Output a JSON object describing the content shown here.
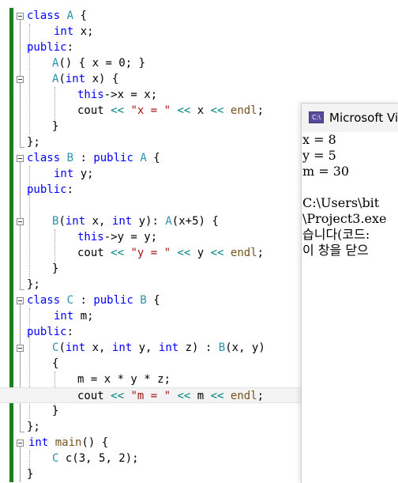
{
  "editor": {
    "lines": [
      "class A {",
      "int x;",
      "public:",
      "A() { x = 0; }",
      "A(int x) {",
      "this->x = x;",
      "cout << \"x = \" << x << endl;",
      "}",
      "};",
      "class B : public A {",
      "int y;",
      "public:",
      "",
      "B(int x, int y): A(x+5) {",
      "this->y = y;",
      "cout << \"y = \" << y << endl;",
      "}",
      "};",
      "class C : public B {",
      "int m;",
      "public:",
      "C(int x, int y, int z) : B(x, y)",
      "{",
      "m = x * y * z;",
      "cout << \"m = \" << m << endl;",
      "}",
      "};",
      "int main() {",
      "C c(3, 5, 2);",
      "}"
    ],
    "highlighted_line": 25
  },
  "console": {
    "title": "Microsoft Visual Studio Debug Console",
    "output_lines": [
      "x = 8",
      "y = 5",
      "m = 30",
      "",
      "C:\\Users\\bit",
      "\\Project3.exe",
      "습니다(코드:",
      "이 창을 닫으"
    ]
  },
  "colors": {
    "keyword": "#0000ff",
    "type": "#2b91af",
    "string": "#a31515",
    "operator": "#008080",
    "function": "#74531f",
    "change_bar": "#1b7f22"
  },
  "icons": {
    "console_app": "visual-studio-console-icon",
    "fold_toggle": "collapse-minus-icon"
  }
}
